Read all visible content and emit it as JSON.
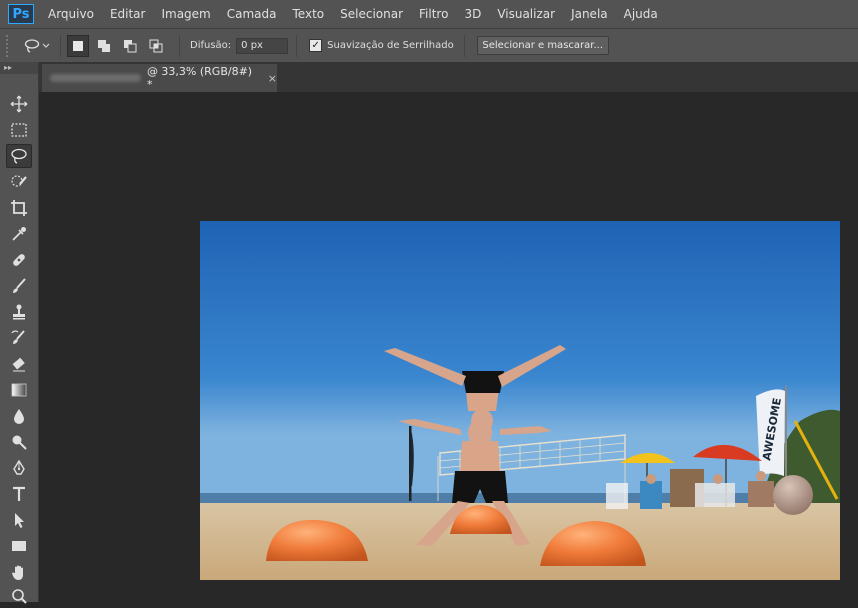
{
  "app": {
    "logo": "Ps"
  },
  "menu": [
    "Arquivo",
    "Editar",
    "Imagem",
    "Camada",
    "Texto",
    "Selecionar",
    "Filtro",
    "3D",
    "Visualizar",
    "Janela",
    "Ajuda"
  ],
  "options": {
    "tool_icon": "lasso-icon",
    "feather_label": "Difusão:",
    "feather_value": "0 px",
    "antialias_checked": true,
    "antialias_label": "Suavização de Serrilhado",
    "select_mask_label": "Selecionar e mascarar..."
  },
  "document": {
    "tab_title": "@ 33,3% (RGB/8#) *",
    "close": "×"
  },
  "tools": [
    "move-icon",
    "marquee-icon",
    "lasso-icon",
    "quick-selection-icon",
    "crop-icon",
    "eyedropper-icon",
    "healing-brush-icon",
    "brush-icon",
    "clone-stamp-icon",
    "history-brush-icon",
    "eraser-icon",
    "gradient-icon",
    "blur-icon",
    "dodge-icon",
    "pen-icon",
    "type-icon",
    "path-selection-icon",
    "rectangle-icon",
    "hand-icon",
    "zoom-icon"
  ],
  "photo": {
    "banner_text": "AWESOME"
  },
  "colors": {
    "chrome": "#535353",
    "canvas": "#282828",
    "accent": "#31a8ff",
    "sky": "#2f78c2",
    "ball": "#f07b3a"
  }
}
